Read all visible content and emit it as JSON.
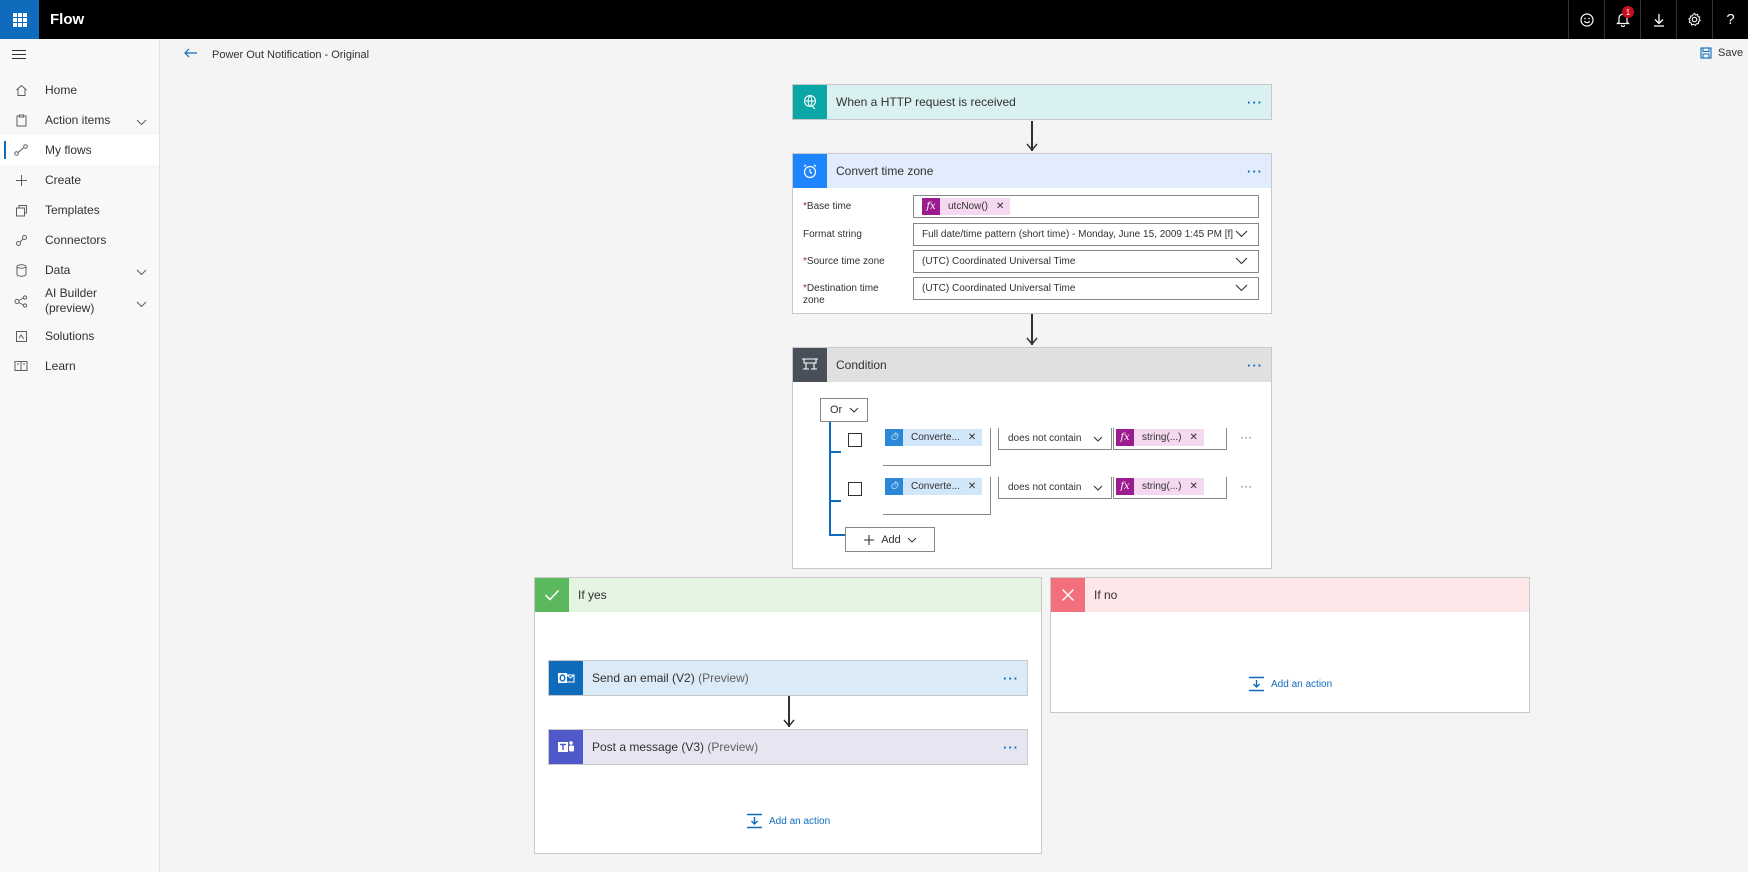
{
  "app": {
    "name": "Flow"
  },
  "topbar": {
    "notification_count": "1"
  },
  "sidebar": {
    "items": [
      {
        "label": "Home"
      },
      {
        "label": "Action items"
      },
      {
        "label": "My flows"
      },
      {
        "label": "Create"
      },
      {
        "label": "Templates"
      },
      {
        "label": "Connectors"
      },
      {
        "label": "Data"
      },
      {
        "label": "AI Builder (preview)"
      },
      {
        "label": "Solutions"
      },
      {
        "label": "Learn"
      }
    ]
  },
  "header": {
    "title": "Power Out Notification - Original",
    "save_label": "Save"
  },
  "trigger": {
    "title": "When a HTTP request is received",
    "color": "#0ba6a6"
  },
  "convert": {
    "title": "Convert time zone",
    "color": "#1f85ff",
    "fields": {
      "base_time_label": "Base time",
      "base_time_token": "utcNow()",
      "format_label": "Format string",
      "format_value": "Full date/time pattern (short time) - Monday, June 15, 2009 1:45 PM [f]",
      "source_label": "Source time zone",
      "source_value": "(UTC) Coordinated Universal Time",
      "dest_label": "Destination time zone",
      "dest_value": "(UTC) Coordinated Universal Time"
    }
  },
  "condition": {
    "title": "Condition",
    "color": "#484f58",
    "group_operator": "Or",
    "rows": [
      {
        "left_token": "Converte...",
        "operator": "does not contain",
        "right_token": "string(...)"
      },
      {
        "left_token": "Converte...",
        "operator": "does not contain",
        "right_token": "string(...)"
      }
    ],
    "add_label": "Add"
  },
  "if_yes": {
    "title": "If yes",
    "color": "#5cb85c",
    "actions": [
      {
        "title": "Send an email (V2)",
        "suffix": "(Preview)",
        "color": "#0f6cbd"
      },
      {
        "title": "Post a message (V3)",
        "suffix": "(Preview)",
        "color": "#5059c9"
      }
    ],
    "add_action": "Add an action"
  },
  "if_no": {
    "title": "If no",
    "color": "#f1707b",
    "add_action": "Add an action"
  }
}
